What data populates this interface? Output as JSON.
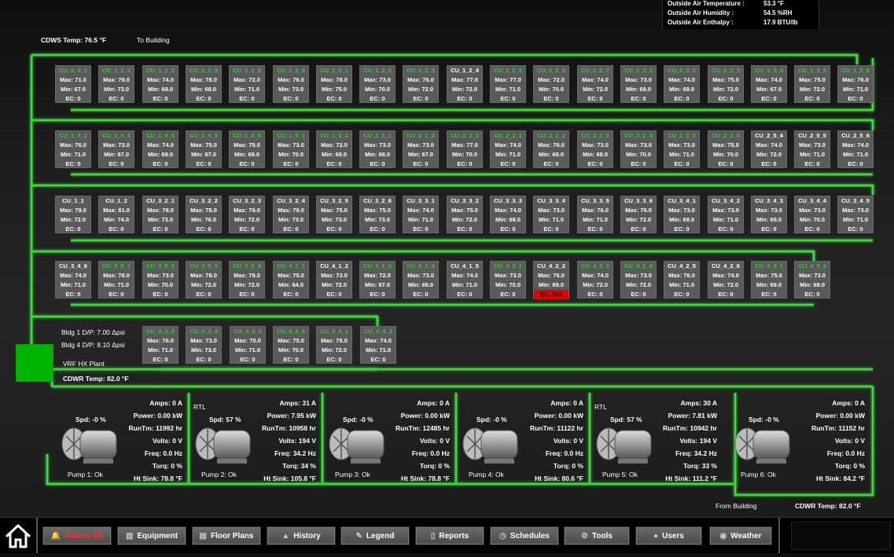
{
  "outside_air": {
    "temp_label": "Outside Air Temperature :",
    "temp_value": "53.3 °F",
    "humidity_label": "Outside Air Humidity :",
    "humidity_value": "54.5 %RH",
    "enthalpy_label": "Outside Air Enthalpy :",
    "enthalpy_value": "17.9 BTU/lb"
  },
  "header": {
    "cdws_temp": "CDWS Temp: 76.5 °F",
    "to_building": "To Building"
  },
  "condensing_units": [
    {
      "name": "CU_1_4_1",
      "max": "Max: 71.0",
      "min": "Min: 67.0",
      "ec": "EC: 0"
    },
    {
      "name": "CU_1_1_1",
      "max": "Max: 79.0",
      "min": "Min: 73.0",
      "ec": "EC: 0"
    },
    {
      "name": "CU_1_1_2",
      "max": "Max: 74.0",
      "min": "Min: 69.0",
      "ec": "EC: 0"
    },
    {
      "name": "CU_1_1_3",
      "max": "Max: 78.0",
      "min": "Min: 68.0",
      "ec": "EC: 0"
    },
    {
      "name": "CU_1_1_5",
      "max": "Max: 72.0",
      "min": "Min: 71.0",
      "ec": "EC: 0"
    },
    {
      "name": "CU_1_1_6",
      "max": "Max: 76.0",
      "min": "Min: 73.0",
      "ec": "EC: 0"
    },
    {
      "name": "CU_1_2_1",
      "max": "Max: 78.0",
      "min": "Min: 75.0",
      "ec": "EC: 0"
    },
    {
      "name": "CU_1_2_2",
      "max": "Max: 73.0",
      "min": "Min: 70.0",
      "ec": "EC: 0"
    },
    {
      "name": "CU_1_2_3",
      "max": "Max: 76.0",
      "min": "Min: 72.0",
      "ec": "EC: 0"
    },
    {
      "name": "CU_1_2_4",
      "max": "Max: 77.0",
      "min": "Min: 72.0",
      "ec": "EC: 0"
    },
    {
      "name": "CU_1_2_5",
      "max": "Max: 77.0",
      "min": "Min: 71.0",
      "ec": "EC: 0"
    },
    {
      "name": "CU_1_2_6",
      "max": "Max: 72.0",
      "min": "Min: 70.0",
      "ec": "EC: 0"
    },
    {
      "name": "CU_1_2_7",
      "max": "Max: 74.0",
      "min": "Min: 72.0",
      "ec": "EC: 0"
    },
    {
      "name": "CU_1_3_1",
      "max": "Max: 73.0",
      "min": "Min: 69.0",
      "ec": "EC: 0"
    },
    {
      "name": "CU_1_3_2",
      "max": "Max: 74.0",
      "min": "Min: 69.0",
      "ec": "EC: 0"
    },
    {
      "name": "CU_1_3_3",
      "max": "Max: 75.0",
      "min": "Min: 72.0",
      "ec": "EC: 0"
    },
    {
      "name": "CU_1_3_4",
      "max": "Max: 74.0",
      "min": "Min: 67.0",
      "ec": "EC: 0"
    },
    {
      "name": "CU_1_3_5",
      "max": "Max: 75.0",
      "min": "Min: 72.0",
      "ec": "EC: 0"
    },
    {
      "name": "CU_1_3_6",
      "max": "Max: 76.0",
      "min": "Min: 71.0",
      "ec": "EC: 0"
    },
    {
      "name": "CU_1_4_2",
      "max": "Max: 76.0",
      "min": "Min: 71.0",
      "ec": "EC: 0"
    },
    {
      "name": "CU_1_4_3",
      "max": "Max: 73.0",
      "min": "Min: 67.0",
      "ec": "EC: 0"
    },
    {
      "name": "CU_1_4_4",
      "max": "Max: 74.0",
      "min": "Min: 69.0",
      "ec": "EC: 0"
    },
    {
      "name": "CU_1_4_5",
      "max": "Max: 75.0",
      "min": "Min: 67.0",
      "ec": "EC: 0"
    },
    {
      "name": "CU_1_4_6",
      "max": "Max: 75.0",
      "min": "Min: 69.0",
      "ec": "EC: 0"
    },
    {
      "name": "CU_1_5_1",
      "max": "Max: 73.0",
      "min": "Min: 70.0",
      "ec": "EC: 0"
    },
    {
      "name": "CU_1_5_2",
      "max": "Max: 72.0",
      "min": "Min: 69.0",
      "ec": "EC: 0"
    },
    {
      "name": "CU_2_1_1",
      "max": "Max: 73.0",
      "min": "Min: 68.0",
      "ec": "EC: 0"
    },
    {
      "name": "CU_2_1_2",
      "max": "Max: 73.0",
      "min": "Min: 67.0",
      "ec": "EC: 0"
    },
    {
      "name": "CU_2_1_3",
      "max": "Max: 77.0",
      "min": "Min: 70.0",
      "ec": "EC: 0"
    },
    {
      "name": "CU_2_2_1",
      "max": "Max: 74.0",
      "min": "Min: 71.0",
      "ec": "EC: 0"
    },
    {
      "name": "CU_2_2_2",
      "max": "Max: 76.0",
      "min": "Min: 69.0",
      "ec": "EC: 0"
    },
    {
      "name": "CU_2_2_3",
      "max": "Max: 73.0",
      "min": "Min: 68.0",
      "ec": "EC: 0"
    },
    {
      "name": "CU_2_2_4",
      "max": "Max: 73.0",
      "min": "Min: 70.0",
      "ec": "EC: 0"
    },
    {
      "name": "CU_2_2_5",
      "max": "Max: 73.0",
      "min": "Min: 71.0",
      "ec": "EC: 0"
    },
    {
      "name": "CU_2_2_6",
      "max": "Max: 75.0",
      "min": "Min: 70.0",
      "ec": "EC: 0"
    },
    {
      "name": "CU_2_5_4",
      "max": "Max: 74.0",
      "min": "Min: 72.0",
      "ec": "EC: 0"
    },
    {
      "name": "CU_2_5_5",
      "max": "Max: 73.0",
      "min": "Min: 71.0",
      "ec": "EC: 0"
    },
    {
      "name": "CU_2_5_6",
      "max": "Max: 74.0",
      "min": "Min: 71.0",
      "ec": "EC: 0"
    },
    {
      "name": "CU_1_1",
      "max": "Max: 79.0",
      "min": "Min: 72.0",
      "ec": "EC: 0"
    },
    {
      "name": "CU_1_2",
      "max": "Max: 81.0",
      "min": "Min: 74.0",
      "ec": "EC: 0"
    },
    {
      "name": "CU_3_2_1",
      "max": "Max: 78.0",
      "min": "Min: 73.0",
      "ec": "EC: 0"
    },
    {
      "name": "CU_3_2_2",
      "max": "Max: 78.0",
      "min": "Min: 76.0",
      "ec": "EC: 0"
    },
    {
      "name": "CU_3_2_3",
      "max": "Max: 79.0",
      "min": "Min: 72.0",
      "ec": "EC: 0"
    },
    {
      "name": "CU_3_2_4",
      "max": "Max: 79.0",
      "min": "Min: 73.0",
      "ec": "EC: 0"
    },
    {
      "name": "CU_3_2_5",
      "max": "Max: 75.0",
      "min": "Min: 73.0",
      "ec": "EC: 0"
    },
    {
      "name": "CU_3_2_6",
      "max": "Max: 75.0",
      "min": "Min: 73.0",
      "ec": "EC: 0"
    },
    {
      "name": "CU_3_3_1",
      "max": "Max: 74.0",
      "min": "Min: 71.0",
      "ec": "EC: 0"
    },
    {
      "name": "CU_3_3_2",
      "max": "Max: 75.0",
      "min": "Min: 72.0",
      "ec": "EC: 0"
    },
    {
      "name": "CU_3_3_3",
      "max": "Max: 74.0",
      "min": "Min: 69.0",
      "ec": "EC: 0"
    },
    {
      "name": "CU_3_3_4",
      "max": "Max: 73.0",
      "min": "Min: 71.0",
      "ec": "EC: 0"
    },
    {
      "name": "CU_3_3_5",
      "max": "Max: 76.0",
      "min": "Min: 71.0",
      "ec": "EC: 0"
    },
    {
      "name": "CU_3_3_6",
      "max": "Max: 76.0",
      "min": "Min: 72.0",
      "ec": "EC: 0"
    },
    {
      "name": "CU_3_4_1",
      "max": "Max: 73.0",
      "min": "Min: 69.0",
      "ec": "EC: 0"
    },
    {
      "name": "CU_3_4_2",
      "max": "Max: 73.0",
      "min": "Min: 71.0",
      "ec": "EC: 0"
    },
    {
      "name": "CU_3_4_3",
      "max": "Max: 73.0",
      "min": "Min: 69.0",
      "ec": "EC: 0"
    },
    {
      "name": "CU_3_4_4",
      "max": "Max: 73.0",
      "min": "Min: 70.0",
      "ec": "EC: 0"
    },
    {
      "name": "CU_3_4_5",
      "max": "Max: 73.0",
      "min": "Min: 71.0",
      "ec": "EC: 0"
    },
    {
      "name": "CU_3_4_6",
      "max": "Max: 74.0",
      "min": "Min: 71.0",
      "ec": "EC: 0"
    },
    {
      "name": "CU_3_5_1",
      "max": "Max: 78.0",
      "min": "Min: 71.0",
      "ec": "EC: 0"
    },
    {
      "name": "CU_3_5_2",
      "max": "Max: 73.0",
      "min": "Min: 70.0",
      "ec": "EC: 0"
    },
    {
      "name": "CU_3_5_3",
      "max": "Max: 78.0",
      "min": "Min: 72.0",
      "ec": "EC: 0"
    },
    {
      "name": "CU_3_5_4",
      "max": "Max: 79.0",
      "min": "Min: 72.0",
      "ec": "EC: 0"
    },
    {
      "name": "CU_4_1_1",
      "max": "Max: 75.0",
      "min": "Min: 64.0",
      "ec": "EC: 0"
    },
    {
      "name": "CU_4_1_2",
      "max": "Max: 73.0",
      "min": "Min: 72.0",
      "ec": "EC: 0"
    },
    {
      "name": "CU_4_1_3",
      "max": "Max: 72.0",
      "min": "Min: 67.0",
      "ec": "EC: 0"
    },
    {
      "name": "CU_4_1_4",
      "max": "Max: 73.0",
      "min": "Min: 69.0",
      "ec": "EC: 0"
    },
    {
      "name": "CU_4_1_5",
      "max": "Max: 74.0",
      "min": "Min: 71.0",
      "ec": "EC: 0"
    },
    {
      "name": "CU_4_2_1",
      "max": "Max: 73.0",
      "min": "Min: 70.0",
      "ec": "EC: 0"
    },
    {
      "name": "CU_4_2_2",
      "max": "Max: 76.0",
      "min": "Min: 69.0",
      "ec": "EC: 201"
    },
    {
      "name": "CU_4_2_3",
      "max": "Max: 74.0",
      "min": "Min: 72.0",
      "ec": "EC: 0"
    },
    {
      "name": "CU_4_2_4",
      "max": "Max: 73.0",
      "min": "Min: 72.0",
      "ec": "EC: 0"
    },
    {
      "name": "CU_4_2_5",
      "max": "Max: 76.0",
      "min": "Min: 71.0",
      "ec": "EC: 0"
    },
    {
      "name": "CU_4_2_6",
      "max": "Max: 74.0",
      "min": "Min: 72.0",
      "ec": "EC: 0"
    },
    {
      "name": "CU_4_3_1",
      "max": "Max: 75.0",
      "min": "Min: 69.0",
      "ec": "EC: 0"
    },
    {
      "name": "CU_4_3_2",
      "max": "Max: 73.0",
      "min": "Min: 69.0",
      "ec": "EC: 0"
    },
    {
      "name": "CU_4_3_3",
      "max": "Max: 76.0",
      "min": "Min: 71.0",
      "ec": "EC: 0"
    },
    {
      "name": "CU_4_3_4",
      "max": "Max: 73.0",
      "min": "Min: 73.0",
      "ec": "EC: 0"
    },
    {
      "name": "CU_4_3_5",
      "max": "Max: 75.0",
      "min": "Min: 71.0",
      "ec": "EC: 0"
    },
    {
      "name": "CU_4_3_6",
      "max": "Max: 75.0",
      "min": "Min: 70.0",
      "ec": "EC: 0"
    },
    {
      "name": "CU_4_4_1",
      "max": "Max: 75.0",
      "min": "Min: 72.0",
      "ec": "EC: 0"
    },
    {
      "name": "CU_4_4_2",
      "max": "Max: 74.0",
      "min": "Min: 71.0",
      "ec": "EC: 0"
    }
  ],
  "plant": {
    "bldg1_dp": "Bldg 1 D/P: 7.00 Δpsi",
    "bldg4_dp": "Bldg 4 D/P: 8.10 Δpsi",
    "hx_label": "VRF HX Plant",
    "cdwr_temp": "CDWR Temp: 82.0 °F"
  },
  "pumps": [
    {
      "amps": "Amps: 0 A",
      "power": "Power: 0.00 kW",
      "runtime": "RunTm: 11992 hr",
      "volts": "Volts: 0 V",
      "freq": "Freq: 0.0 Hz",
      "torq": "Torq: 0 %",
      "heatsink": "Ht Sink: 78.8 °F",
      "spd": "Spd: -0 %",
      "rtl": "",
      "status": "Pump 1: Ok"
    },
    {
      "amps": "Amps: 31 A",
      "power": "Power: 7.95 kW",
      "runtime": "RunTm: 10958 hr",
      "volts": "Volts: 194 V",
      "freq": "Freq: 34.2 Hz",
      "torq": "Torq: 34 %",
      "heatsink": "Ht Sink: 105.8 °F",
      "spd": "Spd: 57 %",
      "rtl": "RTL",
      "status": "Pump 2: Ok"
    },
    {
      "amps": "Amps: 0 A",
      "power": "Power: 0.00 kW",
      "runtime": "RunTm: 12485 hr",
      "volts": "Volts: 0 V",
      "freq": "Freq: 0.0 Hz",
      "torq": "Torq: 0 %",
      "heatsink": "Ht Sink: 78.8 °F",
      "spd": "Spd: -0 %",
      "rtl": "",
      "status": "Pump 3: Ok"
    },
    {
      "amps": "Amps: 0 A",
      "power": "Power: 0.00 kW",
      "runtime": "RunTm: 11122 hr",
      "volts": "Volts: 0 V",
      "freq": "Freq: 0.0 Hz",
      "torq": "Torq: 0 %",
      "heatsink": "Ht Sink: 80.6 °F",
      "spd": "Spd: -0 %",
      "rtl": "",
      "status": "Pump 4: Ok"
    },
    {
      "amps": "Amps: 30 A",
      "power": "Power: 7.81 kW",
      "runtime": "RunTm: 10942 hr",
      "volts": "Volts: 194 V",
      "freq": "Freq: 34.2 Hz",
      "torq": "Torq: 33 %",
      "heatsink": "Ht Sink: 111.2 °F",
      "spd": "Spd: 57 %",
      "rtl": "RTL",
      "status": "Pump 5: Ok"
    },
    {
      "amps": "Amps: 0 A",
      "power": "Power: 0.00 kW",
      "runtime": "RunTm: 11152 hr",
      "volts": "Volts: 0 V",
      "freq": "Freq: 0.0 Hz",
      "torq": "Torq: 0 %",
      "heatsink": "Ht Sink: 84.2 °F",
      "spd": "Spd: -0 %",
      "rtl": "",
      "status": "Pump 6: Ok"
    }
  ],
  "footer": {
    "from_building": "From Building",
    "cdwr_temp": "CDWR Temp: 82.0 °F"
  },
  "nav": [
    {
      "label": "Alarms (8)",
      "icon": "bell-icon"
    },
    {
      "label": "Equipment",
      "icon": "factory-icon"
    },
    {
      "label": "Floor Plans",
      "icon": "floorplan-icon"
    },
    {
      "label": "History",
      "icon": "mountain-icon"
    },
    {
      "label": "Legend",
      "icon": "wrench-icon"
    },
    {
      "label": "Reports",
      "icon": "document-icon"
    },
    {
      "label": "Schedules",
      "icon": "clock-icon"
    },
    {
      "label": "Tools",
      "icon": "gear-icon"
    },
    {
      "label": "Users",
      "icon": "user-icon"
    },
    {
      "label": "Weather",
      "icon": "weather-icon"
    }
  ],
  "colors": {
    "pipe": "#3dd63d",
    "alarm": "#e00000",
    "tile": "#5a5a5a",
    "hx": "#00b400",
    "alarm_text": "#ff3030"
  }
}
